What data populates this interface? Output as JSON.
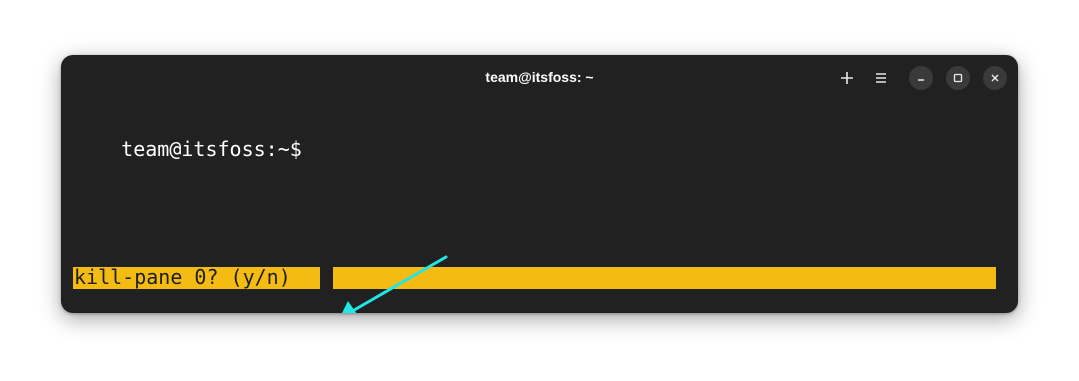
{
  "window": {
    "title": "team@itsfoss: ~",
    "buttons": {
      "new_tab_icon": "plus-icon",
      "menu_icon": "hamburger-menu-icon",
      "minimize_icon": "minimize-icon",
      "maximize_icon": "maximize-icon",
      "close_icon": "close-icon"
    }
  },
  "terminal": {
    "prompt": "team@itsfoss:~$"
  },
  "status_bar": {
    "prompt_text": "kill-pane 0? (y/n)",
    "background_color": "#f4bc13"
  },
  "annotation": {
    "arrow_color": "#22e5e5",
    "arrow_icon": "arrow-icon"
  }
}
